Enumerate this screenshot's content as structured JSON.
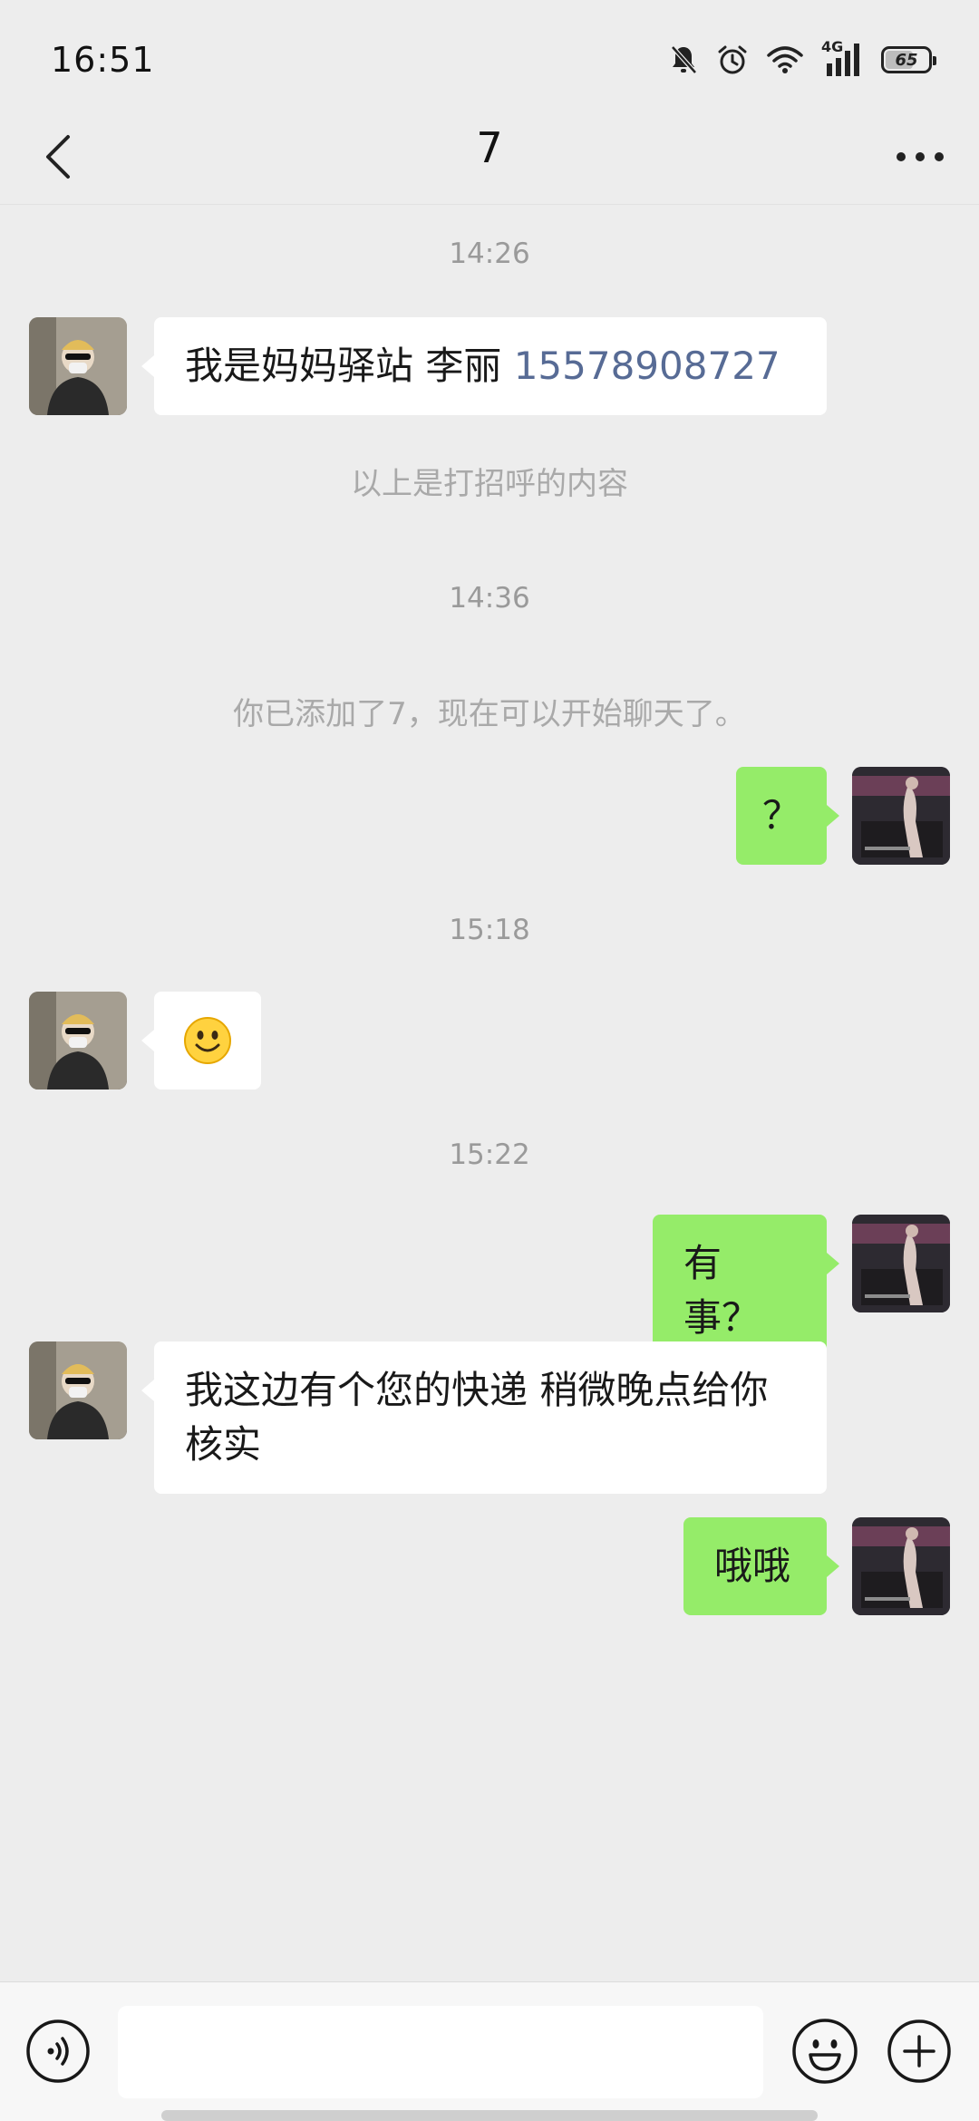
{
  "status_bar": {
    "time": "16:51",
    "battery": "65",
    "battery_level": 0.65,
    "network": "4G"
  },
  "nav": {
    "title": "7"
  },
  "chat": {
    "timestamps": [
      "14:26",
      "14:36",
      "15:18",
      "15:22"
    ],
    "system_notes": [
      "以上是打招呼的内容",
      "你已添加了7，现在可以开始聊天了。"
    ],
    "messages": [
      {
        "side": "in",
        "text": "我是妈妈驿站 李丽 ",
        "link": "15578908727"
      },
      {
        "side": "out",
        "text": "？"
      },
      {
        "side": "in",
        "emoji": "🙂"
      },
      {
        "side": "out",
        "text": "有事？"
      },
      {
        "side": "in",
        "text": "我这边有个您的快递 稍微晚点给你核实"
      },
      {
        "side": "out",
        "text": "哦哦"
      }
    ]
  },
  "input_bar": {
    "placeholder": ""
  },
  "colors": {
    "bg": "#ededed",
    "outgoing_bubble": "#95ec69",
    "incoming_bubble": "#ffffff",
    "link": "#576b95"
  }
}
